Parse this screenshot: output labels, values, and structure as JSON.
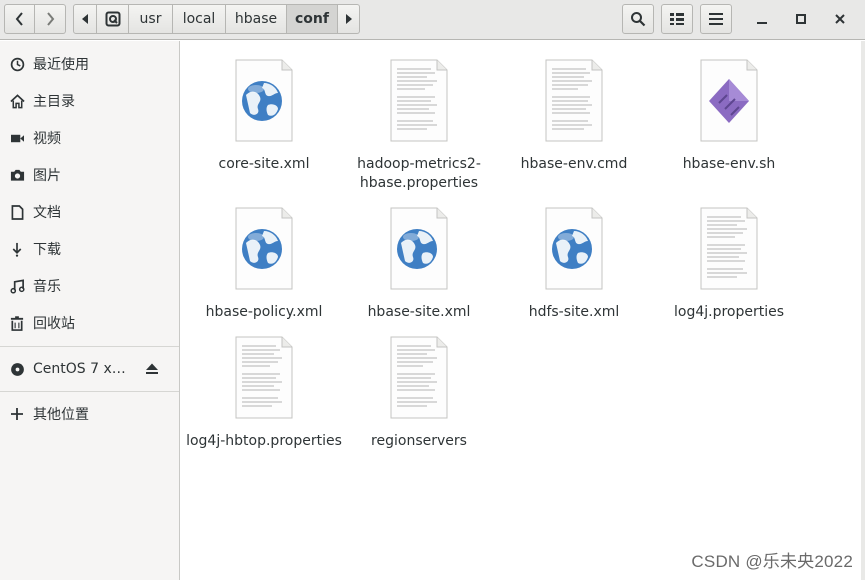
{
  "path": {
    "crumbs": [
      "usr",
      "local",
      "hbase",
      "conf"
    ],
    "active": "conf"
  },
  "sidebar": {
    "items": [
      {
        "label": "最近使用",
        "icon": "clock-icon"
      },
      {
        "label": "主目录",
        "icon": "home-icon"
      },
      {
        "label": "视频",
        "icon": "video-icon"
      },
      {
        "label": "图片",
        "icon": "camera-icon"
      },
      {
        "label": "文档",
        "icon": "document-icon"
      },
      {
        "label": "下载",
        "icon": "download-icon"
      },
      {
        "label": "音乐",
        "icon": "music-icon"
      },
      {
        "label": "回收站",
        "icon": "trash-icon"
      }
    ],
    "device": {
      "label": "CentOS 7 x…",
      "icon": "disc-icon",
      "action_icon": "eject-icon"
    },
    "other": {
      "label": "其他位置",
      "icon": "plus-icon"
    }
  },
  "files": [
    {
      "label": "core-site.xml",
      "icon": "web-document-icon"
    },
    {
      "label": "hadoop-metrics2-hbase.properties",
      "icon": "text-document-icon"
    },
    {
      "label": "hbase-env.cmd",
      "icon": "text-document-icon"
    },
    {
      "label": "hbase-env.sh",
      "icon": "script-document-icon"
    },
    {
      "label": "hbase-policy.xml",
      "icon": "web-document-icon"
    },
    {
      "label": "hbase-site.xml",
      "icon": "web-document-icon"
    },
    {
      "label": "hdfs-site.xml",
      "icon": "web-document-icon"
    },
    {
      "label": "log4j.properties",
      "icon": "text-document-icon"
    },
    {
      "label": "log4j-hbtop.properties",
      "icon": "text-document-icon"
    },
    {
      "label": "regionservers",
      "icon": "text-document-icon"
    }
  ],
  "watermark": "CSDN @乐未央2022",
  "colors": {
    "globe": "#3f7fc4",
    "script": "#8b6bc2",
    "active_crumb": "#d4d4d2"
  }
}
